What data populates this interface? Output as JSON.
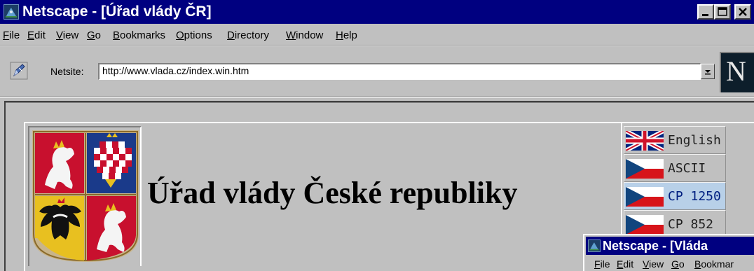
{
  "window": {
    "title": "Netscape - [Úřad vlády ČR]"
  },
  "menubar": {
    "items": [
      "File",
      "Edit",
      "View",
      "Go",
      "Bookmarks",
      "Options",
      "Directory",
      "Window",
      "Help"
    ]
  },
  "location": {
    "label": "Netsite:",
    "url": "http://www.vlada.cz/index.win.htm",
    "throbber_letter": "N"
  },
  "page": {
    "heading": "Úřad vlády České republiky",
    "languages": [
      {
        "label": "English",
        "flag": "uk-flag-icon",
        "selected": false
      },
      {
        "label": "ASCII",
        "flag": "czech-flag-icon",
        "selected": false
      },
      {
        "label": "CP 1250",
        "flag": "czech-flag-icon",
        "selected": true
      },
      {
        "label": "CP 852",
        "flag": "czech-flag-icon",
        "selected": false
      }
    ]
  },
  "second_window": {
    "title": "Netscape - [Vláda ",
    "menu": [
      "File",
      "Edit",
      "View",
      "Go",
      "Bookmar"
    ]
  },
  "colors": {
    "titlebar": "#000080",
    "chrome": "#c0c0c0",
    "selected_language": "#b8d0e8"
  }
}
